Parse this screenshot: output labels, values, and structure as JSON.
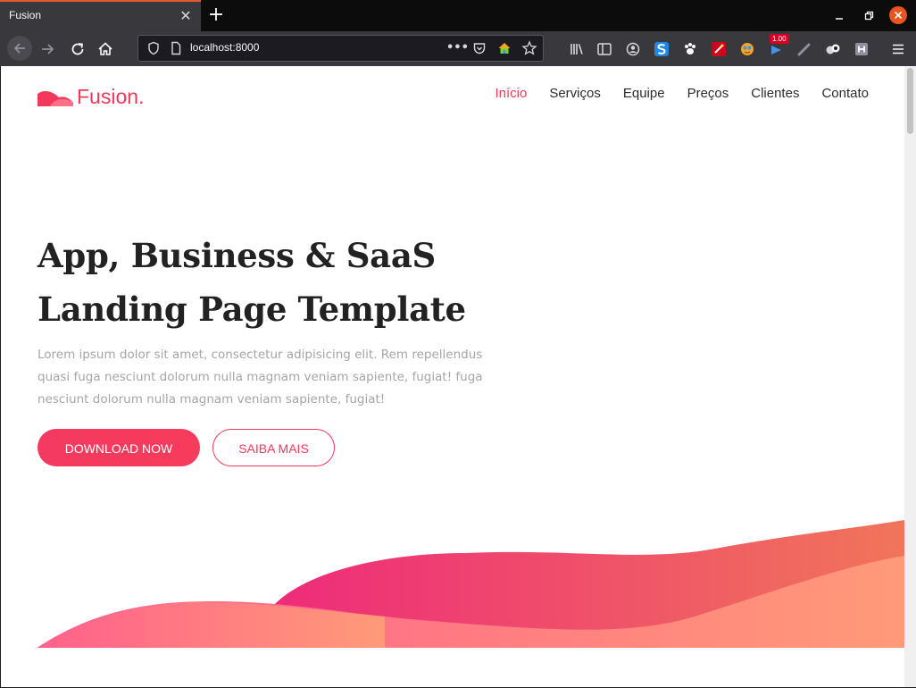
{
  "browser": {
    "tab_title": "Fusion",
    "tab_close": "✕",
    "new_tab": "+",
    "url": "localhost:8000",
    "url_actions": "•••",
    "extension_badge": "1.00",
    "accent": "#e35835",
    "close_color": "#e95420"
  },
  "site": {
    "logo_text": "Fusion.",
    "brand_color": "#f2395b",
    "menu": [
      {
        "label": "Início",
        "active": true
      },
      {
        "label": "Serviços",
        "active": false
      },
      {
        "label": "Equipe",
        "active": false
      },
      {
        "label": "Preços",
        "active": false
      },
      {
        "label": "Clientes",
        "active": false
      },
      {
        "label": "Contato",
        "active": false
      }
    ]
  },
  "hero": {
    "title_line1": "App, Business & SaaS",
    "title_line2": "Landing Page Template",
    "description": "Lorem ipsum dolor sit amet, consectetur adipisicing elit. Rem repellendus quasi fuga nesciunt dolorum nulla magnam veniam sapiente, fugiat! fuga nesciunt dolorum nulla magnam veniam sapiente, fugiat!",
    "primary_button": "DOWNLOAD NOW",
    "secondary_button": "SAIBA MAIS"
  },
  "icons": {
    "back": "back-arrow-icon",
    "forward": "forward-arrow-icon",
    "reload": "reload-icon",
    "home": "home-icon",
    "shield": "shield-icon",
    "page": "page-icon",
    "pocket": "pocket-icon",
    "bookmark": "star-icon",
    "library": "library-icon",
    "sidebar": "sidebar-icon",
    "account": "account-icon",
    "menu": "hamburger-menu-icon"
  },
  "colors": {
    "wave_front_start": "#ff5a8d",
    "wave_front_end": "#ff9a78",
    "wave_back_start": "#ee2b7a",
    "wave_back_end": "#f0755a"
  }
}
